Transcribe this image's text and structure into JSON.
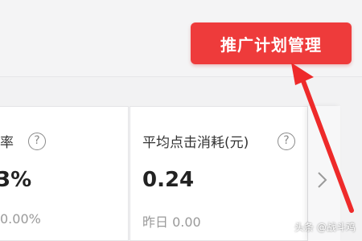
{
  "header": {
    "promo_plan_button_label": "推广计划管理"
  },
  "stats": [
    {
      "label": "率",
      "value": "3%",
      "compare_text": "0.00%"
    },
    {
      "label": "平均点击消耗(元)",
      "value": "0.24",
      "compare_text": "昨日 0.00"
    }
  ],
  "help_glyph": "?",
  "watermark": "头条 @战斗鸡",
  "icons": {
    "help": "question-circle-icon",
    "next": "chevron-right-icon",
    "annotation": "red-arrow-icon"
  },
  "colors": {
    "accent": "#ee3b3b",
    "annotation_arrow": "#ee2a2a",
    "card_bg": "#ffffff",
    "page_bg": "#f2f2f3"
  }
}
